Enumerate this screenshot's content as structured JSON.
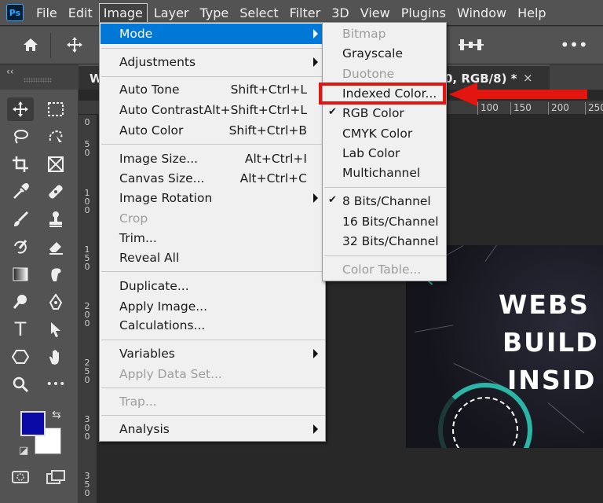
{
  "app": {
    "logo": "Ps"
  },
  "menubar": {
    "items": [
      "File",
      "Edit",
      "Image",
      "Layer",
      "Type",
      "Select",
      "Filter",
      "3D",
      "View",
      "Plugins",
      "Window",
      "Help"
    ],
    "active": "Image"
  },
  "options_bar": {
    "icons": [
      "home-icon",
      "move-icon",
      "align-distribute-icon",
      "more-icon"
    ],
    "more_label": "•••"
  },
  "panel": {
    "collapse_label": "‹‹"
  },
  "document_tab": {
    "name_visible": "W",
    "suffix_visible": "0, RGB/8) *",
    "close": "×"
  },
  "ruler": {
    "top_ticks": [
      "100",
      "150",
      "200",
      "250"
    ],
    "left_ticks": [
      "0",
      "5",
      "0",
      "1",
      "0",
      "0",
      "1",
      "5",
      "0",
      "2",
      "0",
      "0",
      "2",
      "5",
      "0",
      "3",
      "0",
      "0",
      "3",
      "5",
      "0"
    ]
  },
  "canvas": {
    "headline_lines": [
      "WEBS",
      "BUILD",
      "INSID"
    ],
    "colors": {
      "ring": "#2bb5a6",
      "background": "#14141c"
    }
  },
  "toolbar": {
    "tools": [
      "move-tool",
      "rectangular-marquee-tool",
      "lasso-tool",
      "object-selection-tool",
      "crop-tool",
      "frame-tool",
      "eyedropper-tool",
      "spot-healing-tool",
      "brush-tool",
      "clone-stamp-tool",
      "history-brush-tool",
      "eraser-tool",
      "gradient-tool",
      "smudge-tool",
      "dodge-tool",
      "pen-tool",
      "type-tool",
      "path-selection-tool",
      "shape-tool",
      "hand-tool",
      "zoom-tool",
      "more-tools"
    ],
    "type_tool_label": "T",
    "foreground_color": "#0a0aa6",
    "background_color": "#ffffff"
  },
  "image_menu": {
    "mode": "Mode",
    "adjustments": "Adjustments",
    "auto_tone": "Auto Tone",
    "auto_tone_sc": "Shift+Ctrl+L",
    "auto_contrast": "Auto Contrast",
    "auto_contrast_sc": "Alt+Shift+Ctrl+L",
    "auto_color": "Auto Color",
    "auto_color_sc": "Shift+Ctrl+B",
    "image_size": "Image Size...",
    "image_size_sc": "Alt+Ctrl+I",
    "canvas_size": "Canvas Size...",
    "canvas_size_sc": "Alt+Ctrl+C",
    "image_rotation": "Image Rotation",
    "crop": "Crop",
    "trim": "Trim...",
    "reveal_all": "Reveal All",
    "duplicate": "Duplicate...",
    "apply_image": "Apply Image...",
    "calculations": "Calculations...",
    "variables": "Variables",
    "apply_data_set": "Apply Data Set...",
    "trap": "Trap...",
    "analysis": "Analysis"
  },
  "mode_menu": {
    "bitmap": "Bitmap",
    "grayscale": "Grayscale",
    "duotone": "Duotone",
    "indexed_color": "Indexed Color...",
    "rgb_color": "RGB Color",
    "cmyk_color": "CMYK Color",
    "lab_color": "Lab Color",
    "multichannel": "Multichannel",
    "bits8": "8 Bits/Channel",
    "bits16": "16 Bits/Channel",
    "bits32": "32 Bits/Channel",
    "color_table": "Color Table...",
    "checkmark": "✔"
  },
  "annotation": {
    "color": "#e3150f"
  }
}
